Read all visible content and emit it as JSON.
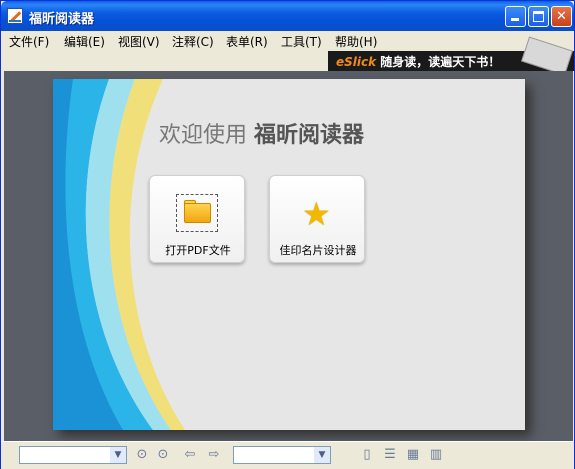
{
  "window": {
    "title": "福昕阅读器"
  },
  "menu": [
    "文件(F)",
    "编辑(E)",
    "视图(V)",
    "注释(C)",
    "表单(R)",
    "工具(T)",
    "帮助(H)"
  ],
  "banner": {
    "brand": "eSlick",
    "text": " 随身读，读遍天下书！"
  },
  "welcome": {
    "prefix": "欢迎使用 ",
    "app": "福昕阅读器"
  },
  "tiles": {
    "open_label": "打开PDF文件",
    "card_label": "佳印名片设计器"
  },
  "icons": {
    "app": "foxit-app-icon",
    "minimize": "minimize-icon",
    "maximize": "maximize-icon",
    "close": "close-icon",
    "folder": "folder-icon",
    "star": "smiley-star-icon",
    "prev": "prev-page-icon",
    "next": "next-page-icon",
    "back": "back-arrow-icon",
    "forward": "forward-arrow-icon",
    "single": "single-page-icon",
    "continuous": "continuous-page-icon",
    "facing": "facing-page-icon",
    "cont-facing": "continuous-facing-icon"
  },
  "colors": {
    "titlebar": "#0a5ce0",
    "close": "#c8401c",
    "banner_brand": "#f08a1a",
    "welcome_text": "#777777"
  }
}
